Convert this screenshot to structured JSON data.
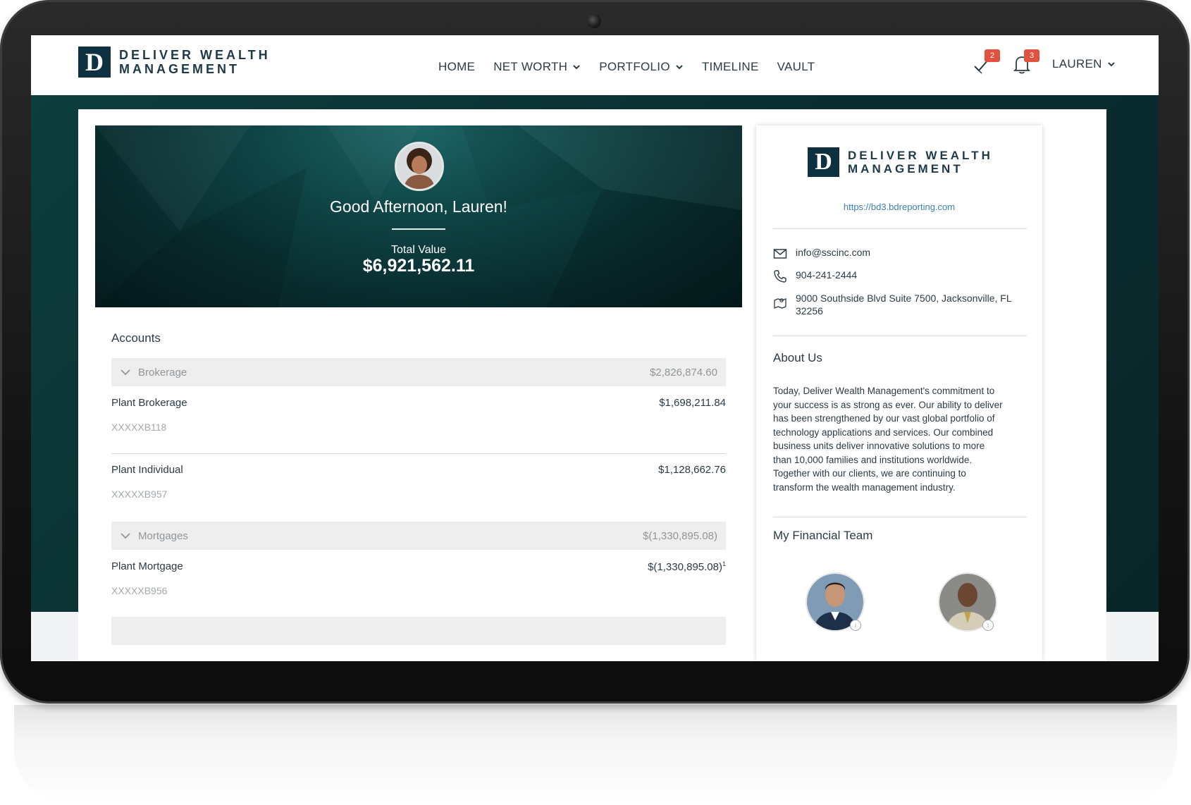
{
  "brand": {
    "mark_letter": "D",
    "line1": "DELIVER WEALTH",
    "line2": "MANAGEMENT",
    "color": "#0d3140"
  },
  "nav": {
    "items": [
      {
        "label": "HOME",
        "active": true
      },
      {
        "label": "NET WORTH",
        "has_dropdown": true
      },
      {
        "label": "PORTFOLIO",
        "has_dropdown": true
      },
      {
        "label": "TIMELINE"
      },
      {
        "label": "VAULT"
      }
    ],
    "tasks_badge": "2",
    "notifications_badge": "3",
    "user_label": "LAUREN"
  },
  "hero": {
    "greeting": "Good Afternoon, Lauren!",
    "total_label": "Total Value",
    "total_value": "$6,921,562.11"
  },
  "accounts": {
    "title": "Accounts",
    "groups": [
      {
        "name": "Brokerage",
        "value": "$2,826,874.60",
        "accounts": [
          {
            "name": "Plant Brokerage",
            "value": "$1,698,211.84",
            "number": "XXXXXB118"
          },
          {
            "name": "Plant Individual",
            "value": "$1,128,662.76",
            "number": "XXXXXB957"
          }
        ]
      },
      {
        "name": "Mortgages",
        "value": "$(1,330,895.08)",
        "accounts": [
          {
            "name": "Plant Mortgage",
            "value": "$(1,330,895.08)",
            "footnote": "1",
            "number": "XXXXXB956"
          }
        ]
      }
    ]
  },
  "firm": {
    "website": "https://bd3.bdreporting.com",
    "email": "info@sscinc.com",
    "phone": "904-241-2444",
    "address_line1": "9000 Southside Blvd Suite 7500, Jacksonville, FL",
    "address_line2": "32256",
    "about_title": "About Us",
    "about_lines": [
      "Today, Deliver Wealth Management's commitment to",
      "your success is as strong as ever. Our ability to deliver",
      "has been strengthened by our vast global portfolio of",
      "technology applications and services. Our combined",
      "business units deliver innovative solutions to more",
      "than 10,000 families and institutions worldwide.",
      "Together with our clients, we are continuing to",
      "transform the wealth management industry."
    ],
    "team_title": "My Financial Team"
  },
  "colors": {
    "teal_dark": "#0a2e30",
    "badge": "#e0513f",
    "link": "#3a80b5",
    "text": "#2c3b44"
  }
}
